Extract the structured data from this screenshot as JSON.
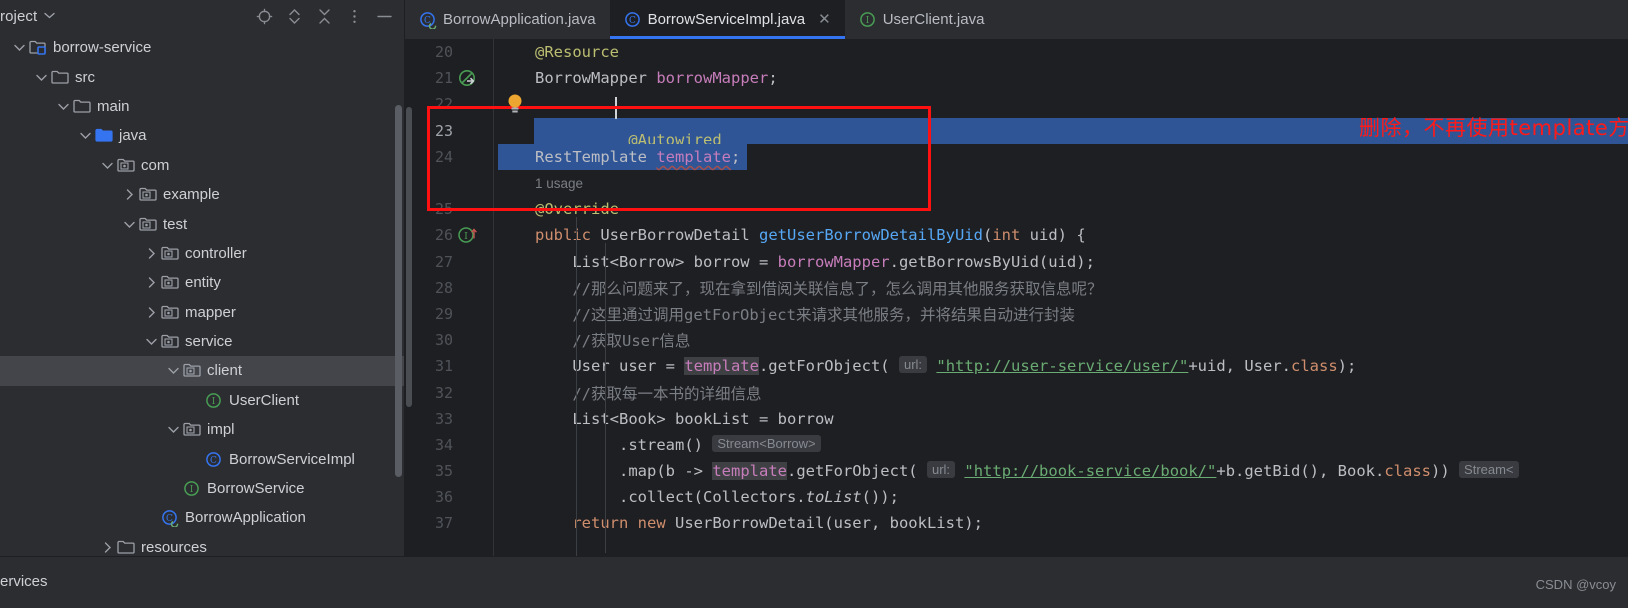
{
  "project_panel": {
    "title": "roject",
    "caret_icon": "chevron-down-icon",
    "tools": [
      {
        "name": "locate-icon",
        "label": "Select Opened File"
      },
      {
        "name": "expand-collapse-icon",
        "label": "Expand / Collapse"
      },
      {
        "name": "collapse-all-icon",
        "label": "Collapse All"
      },
      {
        "name": "more-options-icon",
        "label": "Options"
      },
      {
        "name": "minimize-icon",
        "label": "Hide"
      }
    ],
    "tree": [
      {
        "label": "borrow-service",
        "depth": 0,
        "twisty": "down",
        "icon": "module-folder",
        "selected": false
      },
      {
        "label": "src",
        "depth": 1,
        "twisty": "down",
        "icon": "folder",
        "selected": false
      },
      {
        "label": "main",
        "depth": 2,
        "twisty": "down",
        "icon": "folder",
        "selected": false
      },
      {
        "label": "java",
        "depth": 3,
        "twisty": "down",
        "icon": "source-folder",
        "selected": false
      },
      {
        "label": "com",
        "depth": 4,
        "twisty": "down",
        "icon": "package",
        "selected": false
      },
      {
        "label": "example",
        "depth": 5,
        "twisty": "right",
        "icon": "package",
        "selected": false
      },
      {
        "label": "test",
        "depth": 5,
        "twisty": "down",
        "icon": "package",
        "selected": false
      },
      {
        "label": "controller",
        "depth": 6,
        "twisty": "right",
        "icon": "package",
        "selected": false
      },
      {
        "label": "entity",
        "depth": 6,
        "twisty": "right",
        "icon": "package",
        "selected": false
      },
      {
        "label": "mapper",
        "depth": 6,
        "twisty": "right",
        "icon": "package",
        "selected": false
      },
      {
        "label": "service",
        "depth": 6,
        "twisty": "down",
        "icon": "package",
        "selected": false
      },
      {
        "label": "client",
        "depth": 7,
        "twisty": "down",
        "icon": "package",
        "selected": true
      },
      {
        "label": "UserClient",
        "depth": 8,
        "twisty": "none",
        "icon": "interface",
        "selected": false
      },
      {
        "label": "impl",
        "depth": 7,
        "twisty": "down",
        "icon": "package",
        "selected": false
      },
      {
        "label": "BorrowServiceImpl",
        "depth": 8,
        "twisty": "none",
        "icon": "class",
        "selected": false
      },
      {
        "label": "BorrowService",
        "depth": 7,
        "twisty": "none",
        "icon": "interface",
        "selected": false
      },
      {
        "label": "BorrowApplication",
        "depth": 6,
        "twisty": "none",
        "icon": "spring-class",
        "selected": false
      },
      {
        "label": "resources",
        "depth": 4,
        "twisty": "right",
        "icon": "folder",
        "selected": false
      }
    ]
  },
  "editor": {
    "tabs": [
      {
        "label": "BorrowApplication.java",
        "icon": "spring-class",
        "active": false,
        "closable": false
      },
      {
        "label": "BorrowServiceImpl.java",
        "icon": "class",
        "active": true,
        "closable": true,
        "close_icon": "close-icon"
      },
      {
        "label": "UserClient.java",
        "icon": "interface",
        "active": false,
        "closable": false
      }
    ],
    "annotation": "删除，不再使用template方式",
    "annotation_color": "#ff1a1a",
    "selection_color": "#2f5596",
    "inlay_usage": "1 usage",
    "lines": [
      {
        "num": "20",
        "gutter": "none"
      },
      {
        "num": "21",
        "gutter": "implemented-method-icon"
      },
      {
        "num": "22",
        "gutter": "none"
      },
      {
        "num": "23",
        "gutter": "none"
      },
      {
        "num": "24",
        "gutter": "none"
      },
      {
        "num": "",
        "gutter": "none"
      },
      {
        "num": "25",
        "gutter": "none"
      },
      {
        "num": "26",
        "gutter": "implementing-method-icon"
      },
      {
        "num": "27",
        "gutter": "none"
      },
      {
        "num": "28",
        "gutter": "none"
      },
      {
        "num": "29",
        "gutter": "none"
      },
      {
        "num": "30",
        "gutter": "none"
      },
      {
        "num": "31",
        "gutter": "none"
      },
      {
        "num": "32",
        "gutter": "none"
      },
      {
        "num": "33",
        "gutter": "none"
      },
      {
        "num": "34",
        "gutter": "none"
      },
      {
        "num": "35",
        "gutter": "none"
      },
      {
        "num": "36",
        "gutter": "none"
      },
      {
        "num": "37",
        "gutter": "none"
      }
    ],
    "code": {
      "l20_annotation": "@Resource",
      "l21_type": "BorrowMapper",
      "l21_field": "borrowMapper",
      "l21_semi": ";",
      "l23_annotation": "@Autowired",
      "l24_type": "RestTemplate",
      "l24_field": "template",
      "l24_semi": ";",
      "l25_annotation": "@Override",
      "l26_kw_public": "public",
      "l26_type": "UserBorrowDetail",
      "l26_method": "getUserBorrowDetailByUid",
      "l26_paren_open": "(",
      "l26_kw_int": "int",
      "l26_param": "uid",
      "l26_tail": ") {",
      "l27_type": "List<Borrow>",
      "l27_var": " borrow = ",
      "l27_field": "borrowMapper",
      "l27_tail": ".getBorrowsByUid(uid);",
      "l28_comment": "//那么问题来了，现在拿到借阅关联信息了，怎么调用其他服务获取信息呢？",
      "l29_comment": "//这里通过调用getForObject来请求其他服务，并将结果自动进行封装",
      "l30_comment": "//获取User信息",
      "l31_a": "User user = ",
      "l31_tmpl": "template",
      "l31_b": ".getForObject(",
      "l31_hint": "url:",
      "l31_str": "\"http://user-service/user/\"",
      "l31_c": "+uid, User.",
      "l31_kw": "class",
      "l31_d": ");",
      "l32_comment": "//获取每一本书的详细信息",
      "l33_a": "List<Book> bookList = borrow",
      "l34_a": ".stream()",
      "l34_hint": "Stream<Borrow>",
      "l35_a": ".map(b -> ",
      "l35_tmpl": "template",
      "l35_b": ".getForObject(",
      "l35_hint": "url:",
      "l35_str": "\"http://book-service/book/\"",
      "l35_c": "+b.getBid(), Book.",
      "l35_kw": "class",
      "l35_d": "))",
      "l35_hint2": "Stream<",
      "l36_a": ".collect(Collectors.",
      "l36_ital": "toList",
      "l36_b": "());",
      "l37_kw_return": "return",
      "l37_kw_new": "new",
      "l37_tail": " UserBorrowDetail(user, bookList);"
    }
  },
  "bottom_bar": {
    "services_label": "ervices",
    "watermark": "CSDN @vcoy"
  }
}
